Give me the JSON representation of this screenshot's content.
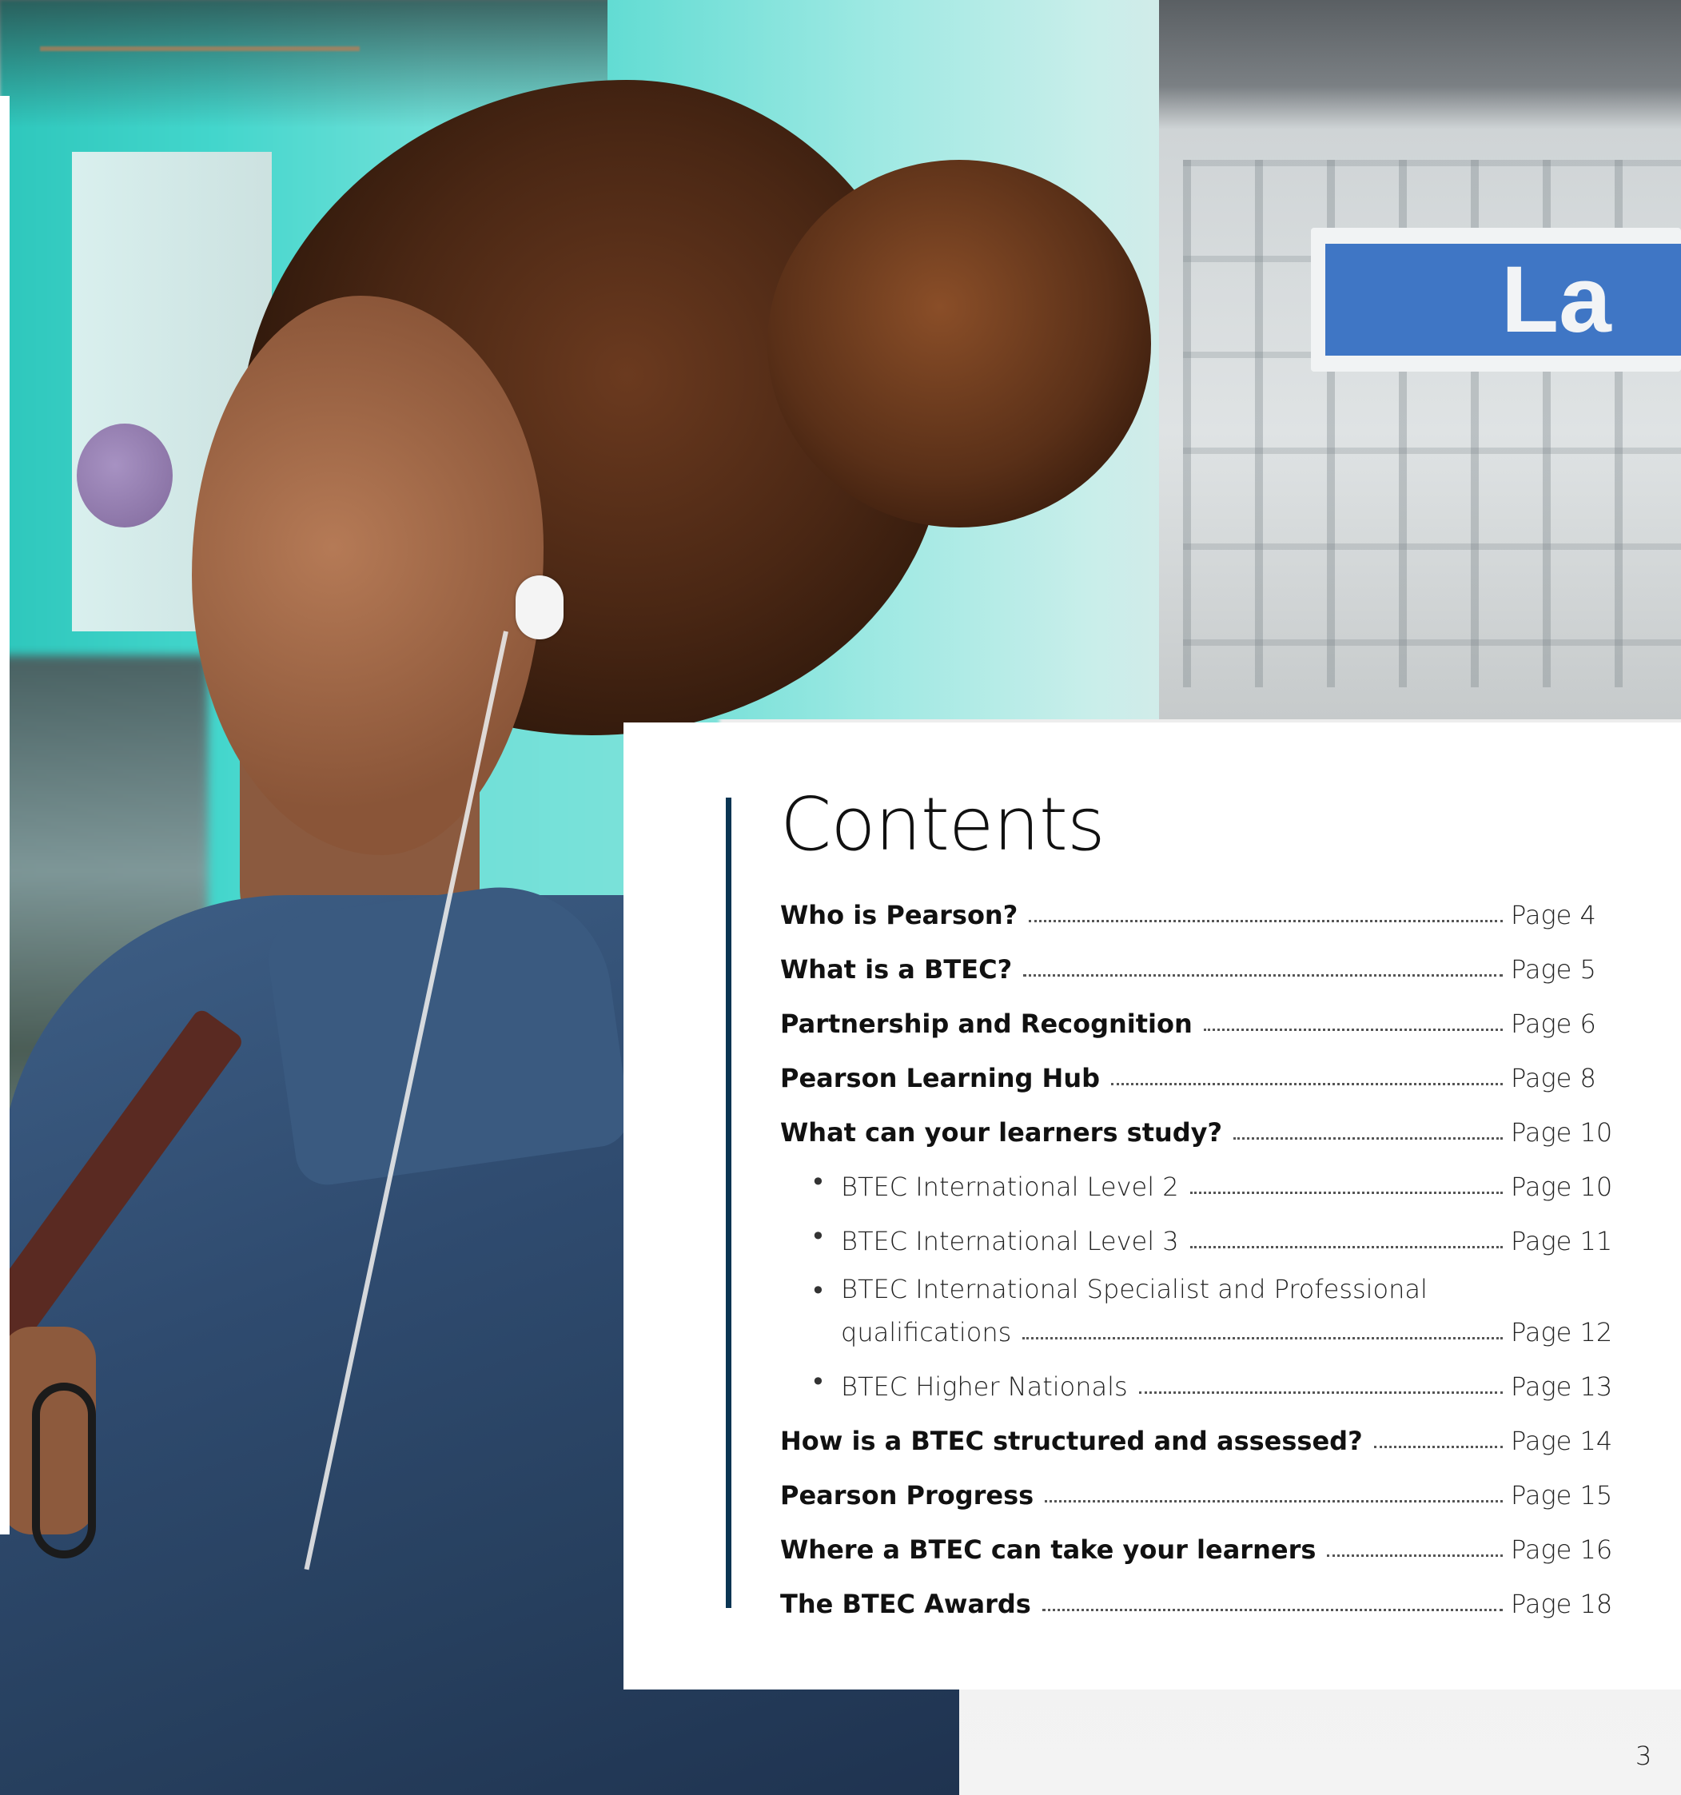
{
  "photo": {
    "station_sign_text": "La C"
  },
  "contents": {
    "heading": "Contents",
    "entries": [
      {
        "title": "Who is Pearson?",
        "page": "Page 4"
      },
      {
        "title": "What is a BTEC?",
        "page": "Page 5"
      },
      {
        "title": "Partnership and Recognition",
        "page": "Page 6"
      },
      {
        "title": "Pearson Learning Hub",
        "page": "Page 8"
      },
      {
        "title": "What can your learners study?",
        "page": "Page 10"
      }
    ],
    "sub_entries": [
      {
        "title": "BTEC International Level 2",
        "page": "Page 10"
      },
      {
        "title": "BTEC International Level 3",
        "page": "Page 11"
      },
      {
        "title_line1": "BTEC International Specialist and Professional",
        "title_line2": "qualifications",
        "page": "Page 12"
      },
      {
        "title": "BTEC Higher Nationals",
        "page": "Page 13"
      }
    ],
    "entries_after": [
      {
        "title": "How is a BTEC structured and assessed?",
        "page": "Page 14"
      },
      {
        "title": "Pearson Progress",
        "page": "Page 15"
      },
      {
        "title": "Where a BTEC can take your learners",
        "page": "Page 16"
      },
      {
        "title": "The BTEC Awards",
        "page": "Page 18"
      }
    ],
    "bullet_glyph": "•"
  },
  "footer": {
    "page_number": "3"
  },
  "colors": {
    "accent_rule": "#0b3553",
    "teal": "#2ec7bc"
  }
}
